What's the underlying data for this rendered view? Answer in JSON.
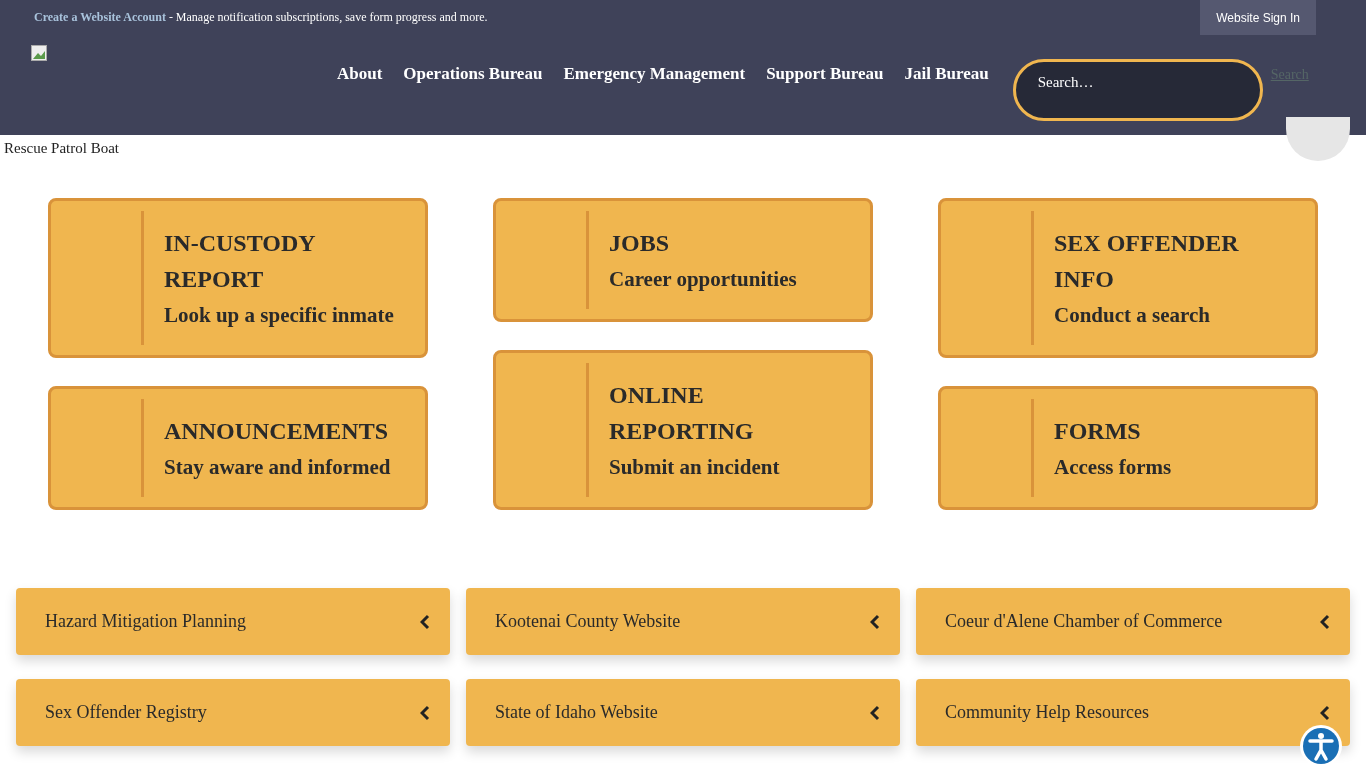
{
  "top_bar": {
    "link": "Create a Website Account",
    "text": " - Manage notification subscriptions, save form progress and more.",
    "sign_in": "Website Sign In"
  },
  "nav": [
    "About",
    "Operations Bureau",
    "Emergency Management",
    "Support Bureau",
    "Jail Bureau"
  ],
  "search": {
    "placeholder": "Search…",
    "button_alt": "Search"
  },
  "hero": {
    "alt": "Rescue Patrol Boat"
  },
  "cards": [
    {
      "title": "IN-CUSTODY REPORT",
      "subtitle": "Look up a specific inmate"
    },
    {
      "title": "ANNOUNCEMENTS",
      "subtitle": "Stay aware and informed"
    },
    {
      "title": "JOBS",
      "subtitle": "Career opportunities"
    },
    {
      "title": "ONLINE REPORTING",
      "subtitle": "Submit an incident"
    },
    {
      "title": "SEX OFFENDER INFO",
      "subtitle": "Conduct a search"
    },
    {
      "title": "FORMS",
      "subtitle": "Access forms"
    }
  ],
  "links": [
    "Hazard Mitigation Planning",
    "Kootenai County Website",
    "Coeur d'Alene Chamber of Commerce",
    "Sex Offender Registry",
    "State of Idaho Website",
    "Community Help Resources"
  ]
}
